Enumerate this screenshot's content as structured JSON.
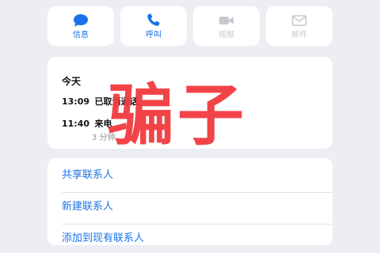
{
  "actions": [
    {
      "label": "信息",
      "icon": "message-icon",
      "enabled": true
    },
    {
      "label": "呼叫",
      "icon": "phone-icon",
      "enabled": true
    },
    {
      "label": "视频",
      "icon": "video-icon",
      "enabled": false
    },
    {
      "label": "邮件",
      "icon": "mail-icon",
      "enabled": false
    }
  ],
  "history": {
    "title": "今天",
    "rows": [
      {
        "time": "13:09",
        "status": "已取消通话"
      },
      {
        "time": "11:40",
        "status": "来电",
        "duration": "3 分钟"
      }
    ]
  },
  "links": [
    {
      "label": "共享联系人"
    },
    {
      "label": "新建联系人"
    },
    {
      "label": "添加到现有联系人"
    }
  ],
  "watermark": "骗子",
  "colors": {
    "accent": "#1a73e8",
    "disabled": "#c7c9cf",
    "watermark": "#f23b3f",
    "background": "#eceef4"
  }
}
